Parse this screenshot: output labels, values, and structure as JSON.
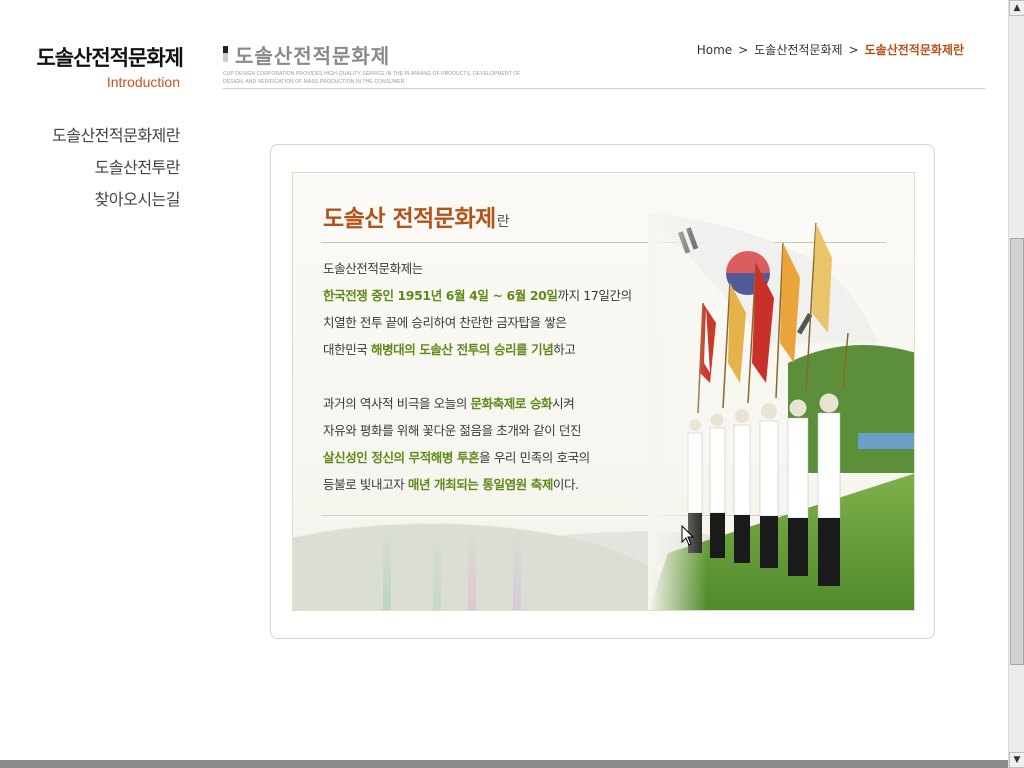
{
  "sidebar": {
    "title": "도솔산전적문화제",
    "subtitle": "Introduction",
    "items": [
      {
        "label": "도솔산전적문화제란"
      },
      {
        "label": "도솔산전투란"
      },
      {
        "label": "찾아오시는길"
      }
    ]
  },
  "header": {
    "title": "도솔산전적문화제",
    "tagline": "CUP DESIGN CORPORATION PROVIDES HIGH-QUALITY SERVICE IN THE PLANNING OF PRODUCTS, DEVELOPMENT OF DESIGN, AND VERIFICATION OF MASS PRODUCTION IN THE CONSUMER"
  },
  "breadcrumb": {
    "home": "Home",
    "separator": ">",
    "parent": "도솔산전적문화제",
    "current": "도솔산전적문화제란"
  },
  "content": {
    "heading_main": "도솔산 전적문화제",
    "heading_suffix": "란",
    "lines": [
      {
        "segments": [
          {
            "t": "도솔산전적문화제는",
            "hl": false
          }
        ]
      },
      {
        "segments": [
          {
            "t": "한국전쟁 중인 1951년 6월 4일 ~ 6월 20일",
            "hl": true
          },
          {
            "t": "까지 17일간의",
            "hl": false
          }
        ]
      },
      {
        "segments": [
          {
            "t": "치열한 전투 끝에 승리하여 찬란한 금자탑을 쌓은",
            "hl": false
          }
        ]
      },
      {
        "segments": [
          {
            "t": "대한민국 ",
            "hl": false
          },
          {
            "t": "해병대의 도솔산 전투의 승리를 기념",
            "hl": true
          },
          {
            "t": "하고",
            "hl": false
          }
        ]
      },
      {
        "gap": true
      },
      {
        "segments": [
          {
            "t": "과거의 역사적 비극을 오늘의 ",
            "hl": false
          },
          {
            "t": "문화축제로 승화",
            "hl": true
          },
          {
            "t": "시켜",
            "hl": false
          }
        ]
      },
      {
        "segments": [
          {
            "t": "자유와 평화를 위해 꽃다운 젊음을 초개와 같이 던진",
            "hl": false
          }
        ]
      },
      {
        "segments": [
          {
            "t": "살신성인 정신의 무적해병 투혼",
            "hl": true
          },
          {
            "t": "을 우리 민족의 호국의",
            "hl": false
          }
        ]
      },
      {
        "segments": [
          {
            "t": "등불로 빛내고자 ",
            "hl": false
          },
          {
            "t": "매년 개최되는 통일염원 축제",
            "hl": true
          },
          {
            "t": "이다.",
            "hl": false
          }
        ]
      }
    ]
  },
  "colors": {
    "accent": "#b4521a",
    "highlight": "#5f8a1a",
    "subtitle": "#d2501e"
  },
  "icons": {
    "scroll_up": "▲",
    "scroll_down": "▼"
  }
}
